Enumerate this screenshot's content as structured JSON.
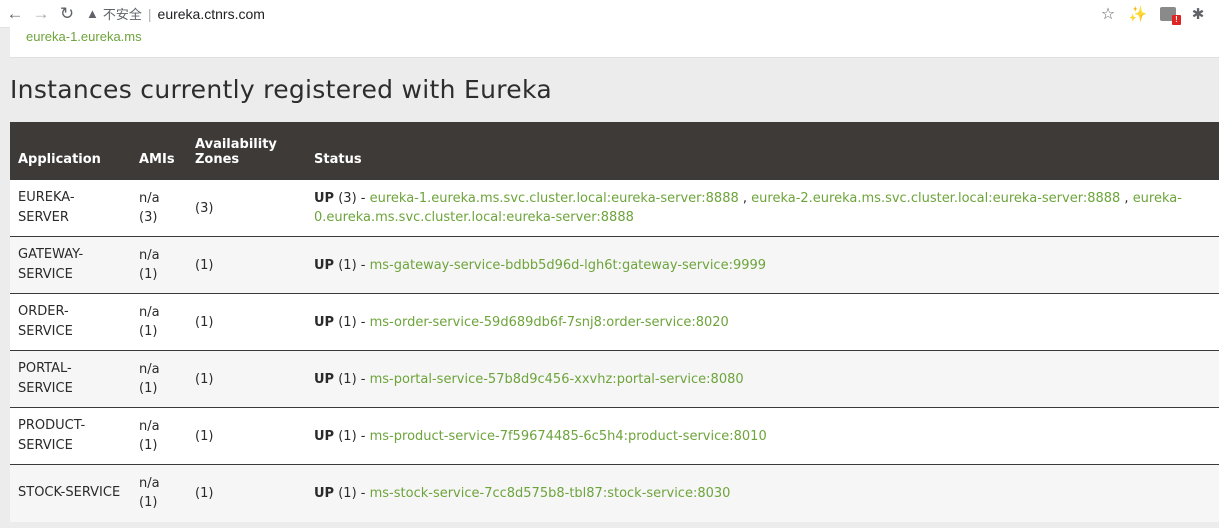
{
  "browser": {
    "insecure_label": "不安全",
    "url": "eureka.ctnrs.com"
  },
  "top_box": {
    "link": "eureka-1.eureka.ms"
  },
  "section_title": "Instances currently registered with Eureka",
  "table": {
    "headers": [
      "Application",
      "AMIs",
      "Availability Zones",
      "Status"
    ],
    "rows": [
      {
        "application": "EUREKA-SERVER",
        "amis": "n/a",
        "amis_count": "(3)",
        "zones": "(3)",
        "status": "UP",
        "count": "(3)",
        "instances": [
          "eureka-1.eureka.ms.svc.cluster.local:eureka-server:8888",
          "eureka-2.eureka.ms.svc.cluster.local:eureka-server:8888",
          "eureka-0.eureka.ms.svc.cluster.local:eureka-server:8888"
        ]
      },
      {
        "application": "GATEWAY-SERVICE",
        "amis": "n/a",
        "amis_count": "(1)",
        "zones": "(1)",
        "status": "UP",
        "count": "(1)",
        "instances": [
          "ms-gateway-service-bdbb5d96d-lgh6t:gateway-service:9999"
        ]
      },
      {
        "application": "ORDER-SERVICE",
        "amis": "n/a",
        "amis_count": "(1)",
        "zones": "(1)",
        "status": "UP",
        "count": "(1)",
        "instances": [
          "ms-order-service-59d689db6f-7snj8:order-service:8020"
        ]
      },
      {
        "application": "PORTAL-SERVICE",
        "amis": "n/a",
        "amis_count": "(1)",
        "zones": "(1)",
        "status": "UP",
        "count": "(1)",
        "instances": [
          "ms-portal-service-57b8d9c456-xxvhz:portal-service:8080"
        ]
      },
      {
        "application": "PRODUCT-SERVICE",
        "amis": "n/a",
        "amis_count": "(1)",
        "zones": "(1)",
        "status": "UP",
        "count": "(1)",
        "instances": [
          "ms-product-service-7f59674485-6c5h4:product-service:8010"
        ]
      },
      {
        "application": "STOCK-SERVICE",
        "amis": "n/a",
        "amis_count": "(1)",
        "zones": "(1)",
        "status": "UP",
        "count": "(1)",
        "instances": [
          "ms-stock-service-7cc8d575b8-tbl87:stock-service:8030"
        ]
      }
    ]
  }
}
